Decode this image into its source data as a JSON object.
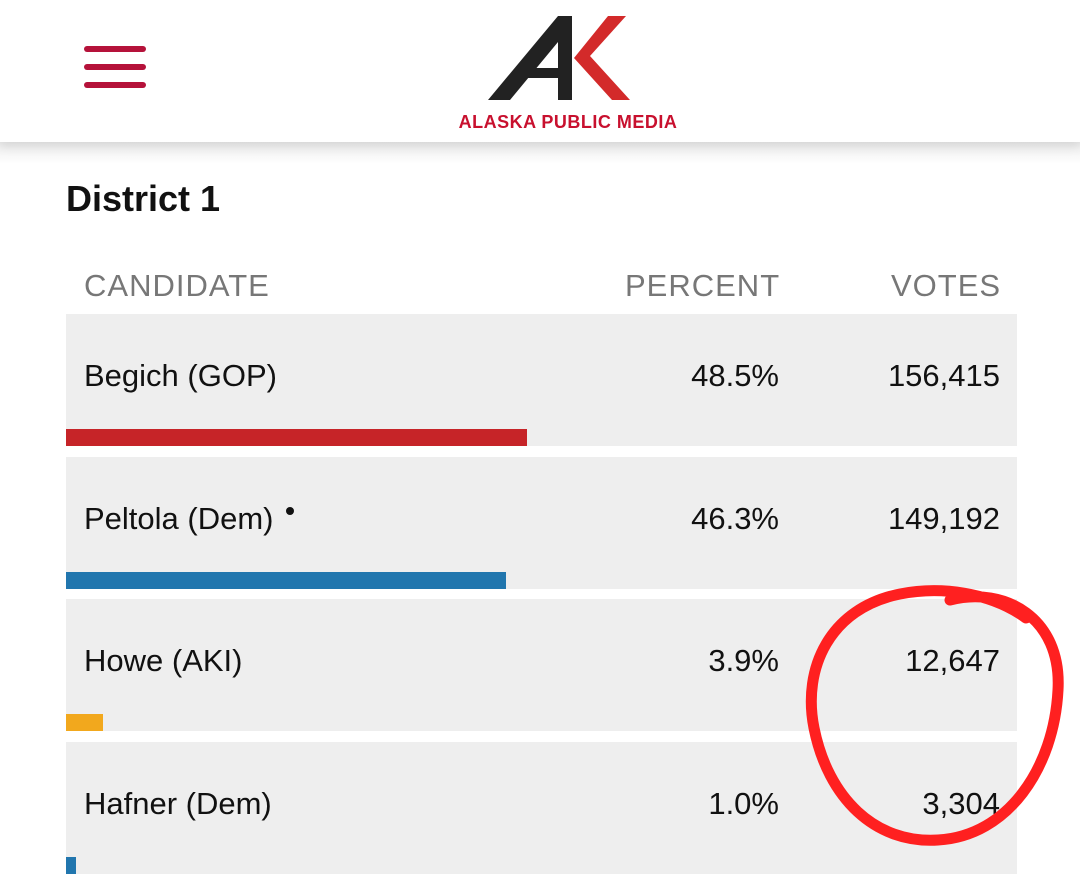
{
  "header": {
    "logo_text": "ALASKA PUBLIC MEDIA",
    "brand_color": "#c8102e"
  },
  "district": {
    "title": "District 1"
  },
  "table": {
    "columns": [
      "CANDIDATE",
      "PERCENT",
      "VOTES"
    ],
    "rows": [
      {
        "name": "Begich (GOP)",
        "percent": "48.5%",
        "votes": "156,415",
        "share": 0.485,
        "color": "#c62428"
      },
      {
        "name": "Peltola (Dem)",
        "percent": "46.3%",
        "votes": "149,192",
        "share": 0.463,
        "color": "#2176ae"
      },
      {
        "name": "Howe (AKI)",
        "percent": "3.9%",
        "votes": "12,647",
        "share": 0.039,
        "color": "#f2a81d"
      },
      {
        "name": "Hafner (Dem)",
        "percent": "1.0%",
        "votes": "3,304",
        "share": 0.01,
        "color": "#2176ae"
      }
    ]
  },
  "annotation": {
    "color": "#ff2020"
  }
}
